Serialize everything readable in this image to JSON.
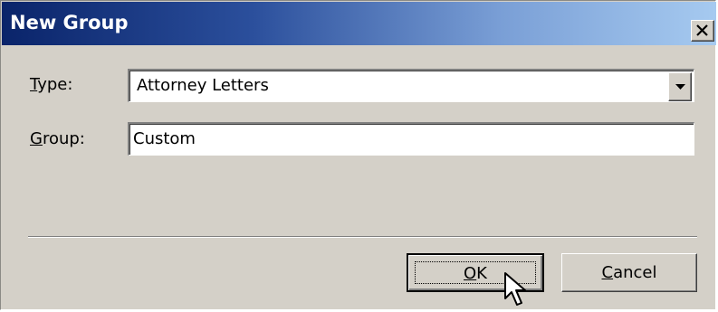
{
  "window": {
    "title": "New Group",
    "close_icon": "close-icon"
  },
  "form": {
    "type_label_mnemonic": "T",
    "type_label_rest": "ype:",
    "type_value": "Attorney Letters",
    "group_label_mnemonic": "G",
    "group_label_rest": "roup:",
    "group_value": "Custom"
  },
  "buttons": {
    "ok_mnemonic": "O",
    "ok_rest": "K",
    "cancel_mnemonic": "C",
    "cancel_rest": "ancel"
  },
  "icons": {
    "dropdown": "chevron-down-icon",
    "cursor": "mouse-pointer-icon"
  },
  "colors": {
    "title_start": "#0a246a",
    "title_end": "#a6caf0",
    "face": "#d4d0c8"
  }
}
